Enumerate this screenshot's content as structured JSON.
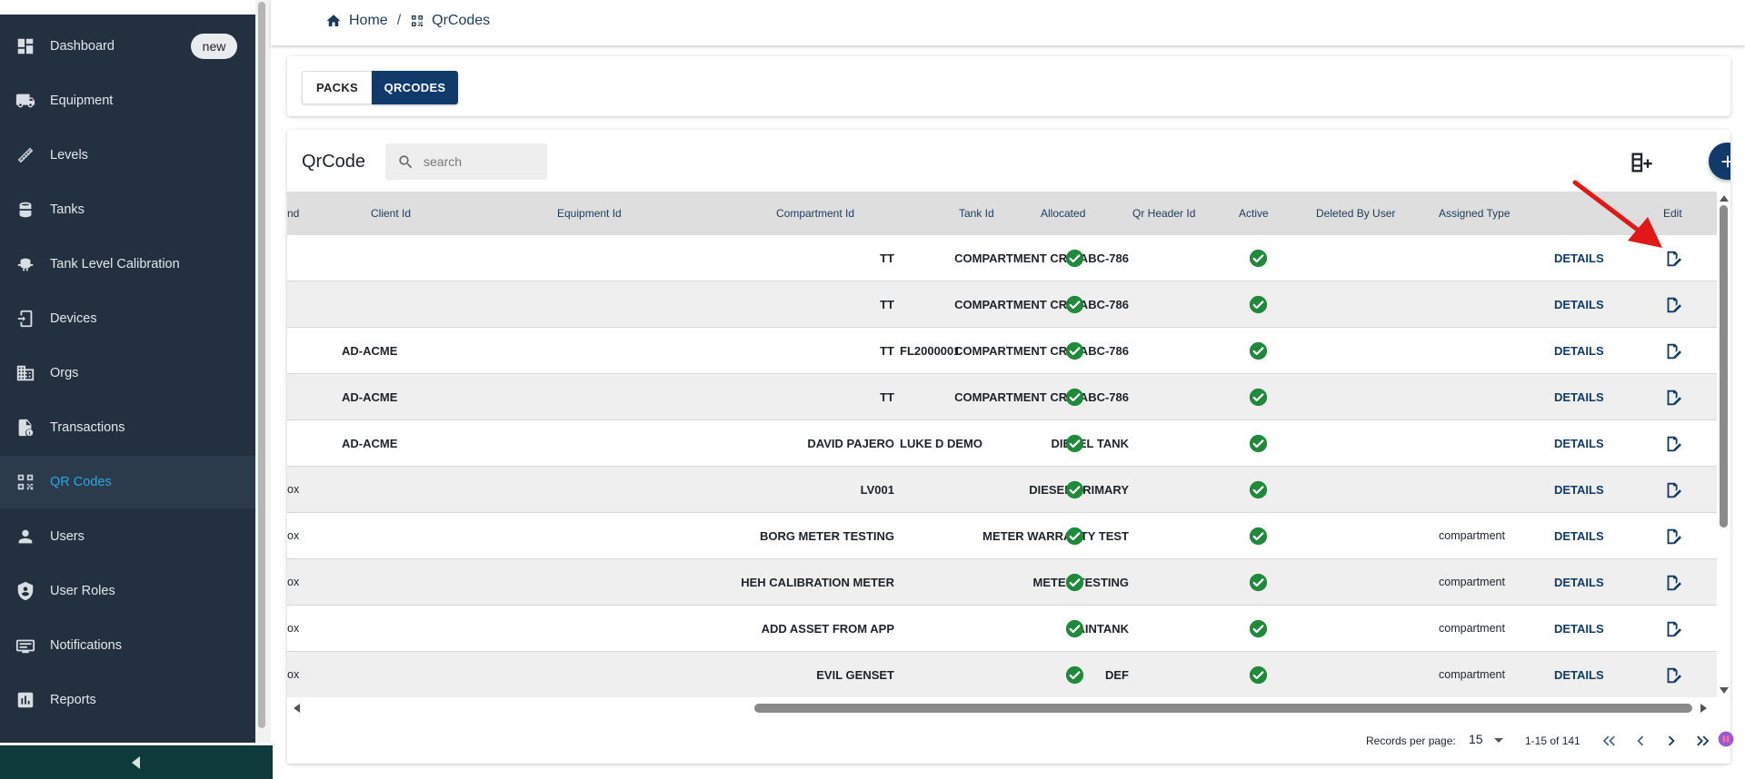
{
  "sidebar": {
    "items": [
      {
        "label": "Dashboard",
        "icon": "dashboard-icon",
        "badge": "new"
      },
      {
        "label": "Equipment",
        "icon": "truck-icon"
      },
      {
        "label": "Levels",
        "icon": "ruler-icon"
      },
      {
        "label": "Tanks",
        "icon": "tank-icon"
      },
      {
        "label": "Tank Level Calibration",
        "icon": "calibration-icon"
      },
      {
        "label": "Devices",
        "icon": "device-icon"
      },
      {
        "label": "Orgs",
        "icon": "building-icon"
      },
      {
        "label": "Transactions",
        "icon": "receipt-icon"
      },
      {
        "label": "QR Codes",
        "icon": "qr-code-icon",
        "active": true
      },
      {
        "label": "Users",
        "icon": "user-icon"
      },
      {
        "label": "User Roles",
        "icon": "shield-icon"
      },
      {
        "label": "Notifications",
        "icon": "notification-icon"
      },
      {
        "label": "Reports",
        "icon": "chart-icon"
      }
    ]
  },
  "breadcrumb": {
    "home": "Home",
    "separator": "/",
    "current": "QrCodes"
  },
  "tabs": [
    {
      "label": "PACKS",
      "active": false
    },
    {
      "label": "QRCODES",
      "active": true
    }
  ],
  "table": {
    "title": "QrCode",
    "search_placeholder": "search",
    "columns": [
      "nd",
      "Client Id",
      "Equipment Id",
      "Compartment Id",
      "Tank Id",
      "Allocated",
      "Qr Header Id",
      "Active",
      "Deleted By User",
      "Assigned Type",
      "",
      "Edit"
    ],
    "details_label": "DETAILS",
    "rows": [
      {
        "first": "",
        "client": "",
        "equipment": "TT",
        "compartment": "COMPARTMENT CRR-ABC-786",
        "tank": "",
        "assigned": ""
      },
      {
        "first": "",
        "client": "",
        "equipment": "TT",
        "compartment": "COMPARTMENT CRR-ABC-786",
        "tank": "",
        "assigned": ""
      },
      {
        "first": "",
        "client": "AD-ACME",
        "equipment": "TT",
        "compartment": "COMPARTMENT CRR-ABC-786",
        "tank": "FL2000001",
        "assigned": ""
      },
      {
        "first": "",
        "client": "AD-ACME",
        "equipment": "TT",
        "compartment": "COMPARTMENT CRR-ABC-786",
        "tank": "",
        "assigned": ""
      },
      {
        "first": "",
        "client": "AD-ACME",
        "equipment": "DAVID PAJERO",
        "compartment": "DIESEL TANK",
        "tank": "LUKE D DEMO",
        "assigned": ""
      },
      {
        "first": "ox",
        "client": "",
        "equipment": "LV001",
        "compartment": "DIESEL PRIMARY",
        "tank": "",
        "assigned": ""
      },
      {
        "first": "ox",
        "client": "",
        "equipment": "BORG METER TESTING",
        "compartment": "METER WARRANTY TEST",
        "tank": "",
        "assigned": "compartment"
      },
      {
        "first": "ox",
        "client": "",
        "equipment": "HEH CALIBRATION METER",
        "compartment": "METER TESTING",
        "tank": "",
        "assigned": "compartment"
      },
      {
        "first": "ox",
        "client": "",
        "equipment": "ADD ASSET FROM APP",
        "compartment": "MAINTANK",
        "tank": "",
        "assigned": "compartment"
      },
      {
        "first": "ox",
        "client": "",
        "equipment": "EVIL GENSET",
        "compartment": "DEF",
        "tank": "",
        "assigned": "compartment"
      }
    ]
  },
  "pagination": {
    "records_per_page_label": "Records per page:",
    "records_per_page": "15",
    "range": "1-15 of 141"
  },
  "colors": {
    "sidebar_bg": "#22303f",
    "accent": "#0f3a6a",
    "active_link": "#2aa7e0",
    "check_green": "#1e8a3a",
    "annotation_red": "#e01818"
  }
}
